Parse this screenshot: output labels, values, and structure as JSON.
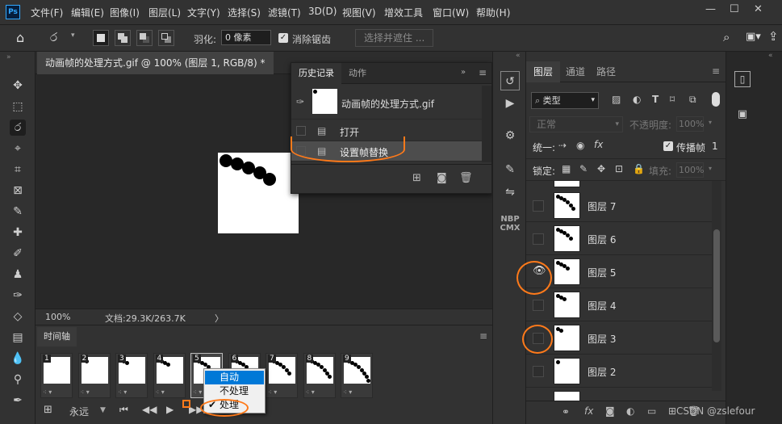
{
  "app": {
    "logo": "Ps"
  },
  "menu": [
    "文件(F)",
    "编辑(E)",
    "图像(I)",
    "图层(L)",
    "文字(Y)",
    "选择(S)",
    "滤镜(T)",
    "3D(D)",
    "视图(V)",
    "增效工具",
    "窗口(W)",
    "帮助(H)"
  ],
  "window_controls": [
    "—",
    "☐",
    "✕"
  ],
  "options": {
    "feather_label": "羽化:",
    "feather_value": "0 像素",
    "antialias_label": "消除锯齿",
    "antialias_checked": true,
    "select_mask_label": "选择并遮住 ..."
  },
  "document": {
    "tab_title": "动画帧的处理方式.gif @ 100% (图层 1, RGB/8) *",
    "zoom": "100%",
    "doc_size": "文档:29.3K/263.7K",
    "status_arrow": "〉"
  },
  "history_panel": {
    "tabs": [
      "历史记录",
      "动作"
    ],
    "snapshot_name": "动画帧的处理方式.gif",
    "states": [
      {
        "label": "打开",
        "selected": false
      },
      {
        "label": "设置帧替换",
        "selected": true
      }
    ]
  },
  "timeline": {
    "tab": "时间轴",
    "frames": [
      {
        "num": "1",
        "dots": 0
      },
      {
        "num": "2",
        "dots": 1
      },
      {
        "num": "3",
        "dots": 2
      },
      {
        "num": "4",
        "dots": 3
      },
      {
        "num": "5",
        "dots": 4
      },
      {
        "num": "6",
        "dots": 5
      },
      {
        "num": "7",
        "dots": 6
      },
      {
        "num": "8",
        "dots": 7
      },
      {
        "num": "9",
        "dots": 8
      }
    ],
    "selected_frame": 5,
    "loop_label": "永远",
    "context_menu": [
      {
        "label": "自动",
        "checked": false,
        "highlighted": true
      },
      {
        "label": "不处理",
        "checked": false,
        "highlighted": false
      },
      {
        "label": "处理",
        "checked": true,
        "highlighted": false
      }
    ]
  },
  "layers_panel": {
    "tabs": [
      "图层",
      "通道",
      "路径"
    ],
    "filter_label": "类型",
    "blend_mode": "正常",
    "opacity_label": "不透明度:",
    "opacity_value": "100%",
    "unify_label": "统一:",
    "propagate_label": "传播帧",
    "propagate_value": "1",
    "lock_label": "锁定:",
    "fill_label": "填充:",
    "fill_value": "100%",
    "layers": [
      {
        "name": "图层 7",
        "visible": false,
        "dots": 6
      },
      {
        "name": "图层 6",
        "visible": false,
        "dots": 5
      },
      {
        "name": "图层 5",
        "visible": true,
        "dots": 4
      },
      {
        "name": "图层 4",
        "visible": false,
        "dots": 3
      },
      {
        "name": "图层 3",
        "visible": false,
        "dots": 2
      },
      {
        "name": "图层 2",
        "visible": false,
        "dots": 1
      }
    ]
  },
  "dock": {
    "nbp_label": "NBP\nCMX"
  },
  "watermark": "CSDN @zslefour",
  "colors": {
    "highlight_orange": "#ff7a1a",
    "menu_highlight": "#0078d7"
  }
}
